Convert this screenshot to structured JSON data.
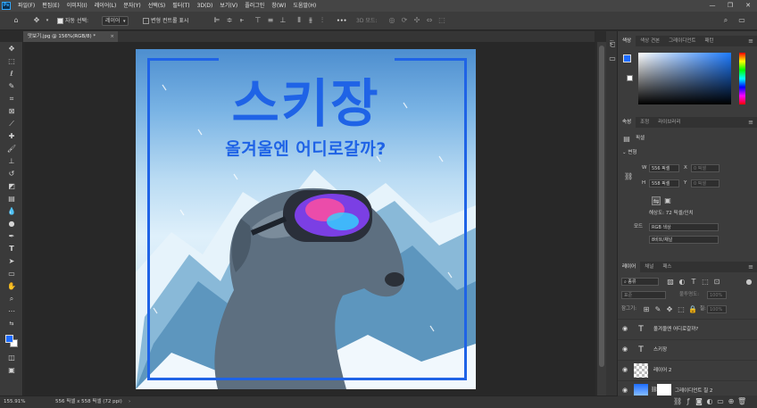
{
  "menubar": {
    "logo": "Ps",
    "items": [
      "파일(F)",
      "편집(E)",
      "이미지(I)",
      "레이어(L)",
      "문자(Y)",
      "선택(S)",
      "필터(T)",
      "3D(D)",
      "보기(V)",
      "플러그인",
      "창(W)",
      "도움말(H)"
    ],
    "window_controls": [
      "—",
      "❐",
      "✕"
    ]
  },
  "options": {
    "auto_select_label": "자동 선택:",
    "auto_select_value": "레이어",
    "transform_controls_label": "변형 컨트롤 표시",
    "more": "•••",
    "mode_3d_label": "3D 모드:"
  },
  "document": {
    "tab_title": "맛보기.jpg @ 156%(RGB/8) *",
    "close": "×"
  },
  "artwork": {
    "title": "스키장",
    "subtitle": "올겨울엔 어디로갈까?",
    "border_color": "#1f63e6"
  },
  "statusbar": {
    "zoom": "155.91%",
    "doc_info": "556 픽셀 x 558 픽셀 (72 ppi)"
  },
  "color_panel": {
    "tabs": [
      "색상",
      "색상 견본",
      "그레이디언트",
      "패턴"
    ],
    "foreground": "#1d6cff",
    "background": "#ffffff"
  },
  "properties_panel": {
    "tabs": [
      "속성",
      "조정",
      "라이브러리"
    ],
    "layer_kind": "픽셀",
    "section": "변형",
    "w_label": "W",
    "w_value": "556 픽셀",
    "x_label": "X",
    "x_value": "0 픽셀",
    "h_label": "H",
    "h_value": "558 픽셀",
    "y_label": "Y",
    "y_value": "0 픽셀",
    "resolution": "해상도: 72 픽셀/인치",
    "mode_label": "모드",
    "mode_value": "RGB 색상",
    "depth_value": "8비트/채널"
  },
  "layers_panel": {
    "tabs": [
      "레이어",
      "채널",
      "패스"
    ],
    "filter_label": "종류",
    "blend_mode": "표준",
    "opacity_label": "불투명도:",
    "opacity_value": "100%",
    "lock_label": "잠그기:",
    "fill_label": "칠:",
    "fill_value": "100%",
    "layers": [
      {
        "name": "올겨울엔 어디로갈까?",
        "thumb": "T"
      },
      {
        "name": "스키장",
        "thumb": "T"
      },
      {
        "name": "레이어 2",
        "thumb": ""
      },
      {
        "name": "그레이디언트 칠 2",
        "thumb": ""
      }
    ]
  }
}
